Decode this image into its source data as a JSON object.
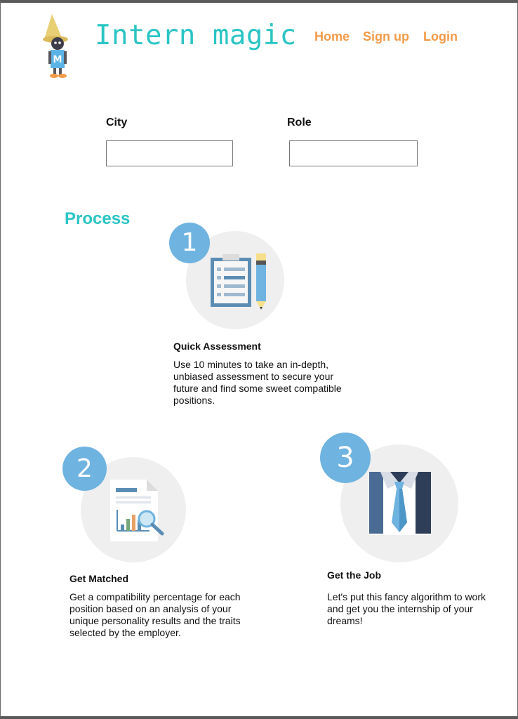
{
  "header": {
    "site_title": "Intern magic",
    "nav": [
      {
        "label": "Home"
      },
      {
        "label": "Sign up"
      },
      {
        "label": "Login"
      }
    ]
  },
  "search": {
    "city_label": "City",
    "city_value": "",
    "role_label": "Role",
    "role_value": ""
  },
  "process": {
    "title": "Process",
    "steps": [
      {
        "number": "1",
        "icon": "clipboard-pencil-icon",
        "title": "Quick Assessment",
        "description": "Use 10 minutes to take an in-depth, unbiased assessment to secure your future and find some sweet compatible positions."
      },
      {
        "number": "2",
        "icon": "report-chart-icon",
        "title": "Get Matched",
        "description": "Get a compatibility percentage for each position based on an analysis of your unique personality results and the traits selected by the employer."
      },
      {
        "number": "3",
        "icon": "suit-tie-icon",
        "title": "Get the Job",
        "description": "Let's put this fancy algorithm to work and get you the internship of your dreams!"
      }
    ]
  },
  "colors": {
    "brand": "#2bc4c4",
    "nav": "#f39a48",
    "badge": "#6fb3e0"
  }
}
